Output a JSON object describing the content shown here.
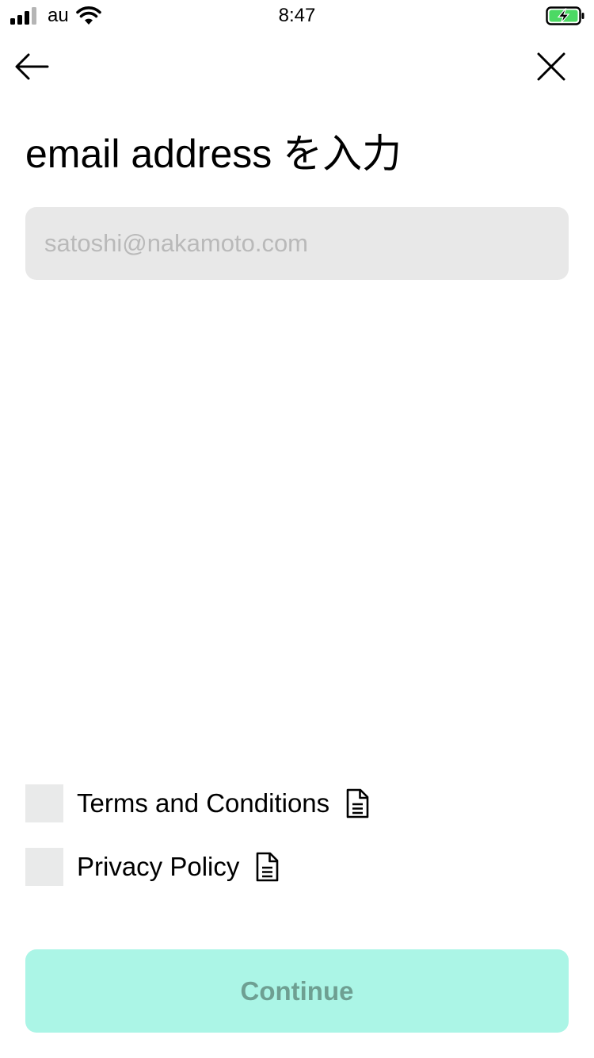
{
  "status_bar": {
    "carrier": "au",
    "time": "8:47",
    "signal_icon": "signal-bars-icon",
    "wifi_icon": "wifi-icon",
    "battery_icon": "battery-charging-icon",
    "battery_color": "#4cd964"
  },
  "nav": {
    "back_icon": "arrow-left-icon",
    "close_icon": "close-icon"
  },
  "page": {
    "title": "email address を入力"
  },
  "email": {
    "value": "",
    "placeholder": "satoshi@nakamoto.com"
  },
  "agreements": [
    {
      "label": "Terms and Conditions",
      "checked": false,
      "icon": "document-icon"
    },
    {
      "label": "Privacy Policy",
      "checked": false,
      "icon": "document-icon"
    }
  ],
  "continue_button": {
    "label": "Continue",
    "enabled": false,
    "background": "#abf5e6",
    "text_color": "#6e9f92"
  }
}
